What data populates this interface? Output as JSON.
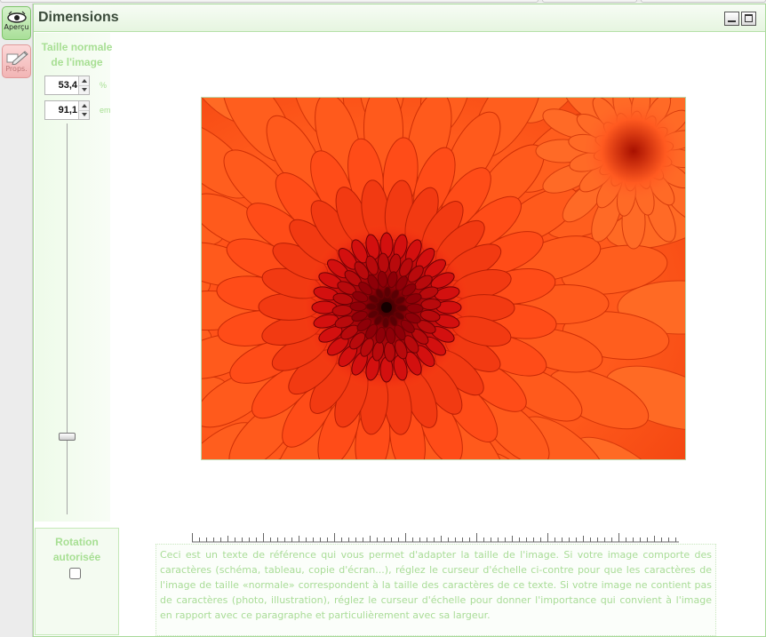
{
  "tabs": [
    {
      "label": "Aperçu",
      "icon": "eye-icon",
      "active": true
    },
    {
      "label": "Props.",
      "icon": "pencil-icon",
      "active": false
    }
  ],
  "window": {
    "title": "Dimensions",
    "minimize_icon": "minimize-icon",
    "maximize_icon": "maximize-icon"
  },
  "size_control": {
    "title": "Taille normale de l'image",
    "percent_value": "53,4",
    "percent_unit": "%",
    "em_value": "91,1",
    "em_unit": "em",
    "scale_fraction": 0.8
  },
  "rotation": {
    "label": "Rotation autorisée",
    "checked": false
  },
  "reference_text": "Ceci est un texte de référence qui vous permet d'adapter la taille de l'image. Si votre image comporte des caractères (schéma, tableau, copie d'écran...), réglez le curseur d'échelle ci-contre pour que les caractères de l'image de taille «normale» correspondent à la taille des caractères de ce texte. Si votre image ne contient pas de caractères (photo, illustration), réglez le curseur d'échelle pour donner l'importance qui convient à l'image en rapport avec ce paragraphe et particulièrement avec sa largeur.",
  "colors": {
    "accent_green": "#a7df93",
    "flower_orange": "#ff4c18",
    "flower_center": "#b1000c"
  }
}
